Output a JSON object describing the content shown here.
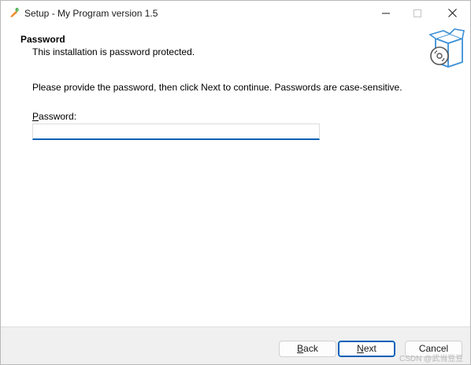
{
  "window": {
    "title": "Setup - My Program version 1.5",
    "app_icon": "carrot-icon"
  },
  "titlebar_buttons": {
    "minimize": "minimize-icon",
    "maximize": "maximize-icon",
    "close": "close-icon"
  },
  "header": {
    "title": "Password",
    "subtitle": "This installation is password protected.",
    "logo": "setup-box-disc-icon"
  },
  "content": {
    "instruction": "Please provide the password, then click Next to continue. Passwords are case-sensitive.",
    "password_label_accel": "P",
    "password_label_rest": "assword:",
    "password_value": "",
    "password_placeholder": ""
  },
  "footer": {
    "back_accel": "B",
    "back_rest": "ack",
    "next_accel": "N",
    "next_rest": "ext",
    "cancel_label": "Cancel"
  },
  "watermark": "CSDN @武当豆豆",
  "colors": {
    "accent": "#005fb8",
    "footer_bg": "#f0f0f0",
    "icon_orange": "#f0892b",
    "icon_green": "#4caf50",
    "logo_blue": "#3a8fd6"
  }
}
